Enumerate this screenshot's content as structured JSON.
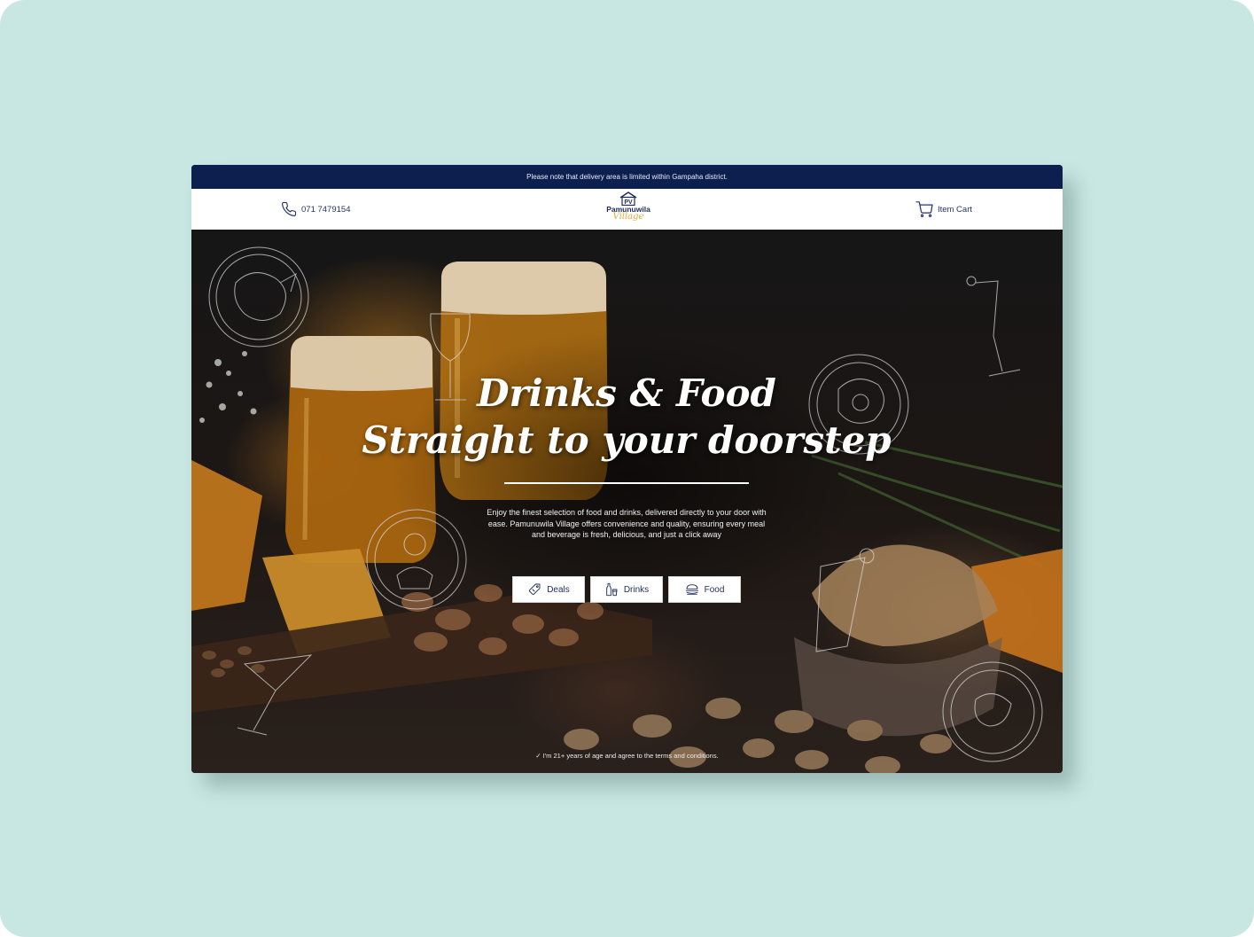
{
  "announcement": "Please note that delivery area is limited within Gampaha district.",
  "header": {
    "phone": "071 7479154",
    "logo_initials": "PV",
    "logo_name": "Pamunuwila",
    "logo_sub": "Village",
    "cart_label": "Item Cart"
  },
  "hero": {
    "headline_line1": "Drinks & Food",
    "headline_line2": "Straight to your doorstep",
    "description": "Enjoy the finest selection of food and drinks, delivered directly to your door with ease. Pamunuwila Village offers convenience and quality, ensuring every meal and beverage is fresh, delicious, and just a click away",
    "buttons": [
      {
        "label": "Deals",
        "icon": "deal-tag-icon"
      },
      {
        "label": "Drinks",
        "icon": "drinks-icon"
      },
      {
        "label": "Food",
        "icon": "food-icon"
      }
    ],
    "terms": "✓ I'm 21+ years of age and agree to the terms and conditions."
  },
  "colors": {
    "frame_background": "#c9e7e2",
    "announcement_bar": "#0d1f4f",
    "brand_navy": "#1f2c5c",
    "brand_gold": "#e3a93a"
  }
}
